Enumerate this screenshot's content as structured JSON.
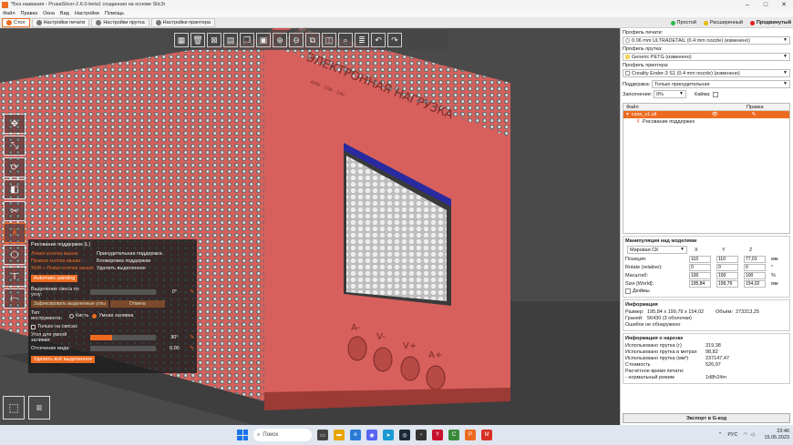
{
  "window": {
    "title": "*Без названия - PrusaSlicer-2.6.0-beta1 созданная на основе Slic3r"
  },
  "menu": [
    "Файл",
    "Правка",
    "Окна",
    "Вид",
    "Настройки",
    "Помощь"
  ],
  "tabs": [
    {
      "label": "Стол"
    },
    {
      "label": "Настройки печати"
    },
    {
      "label": "Настройки прутка"
    },
    {
      "label": "Настройки принтера"
    }
  ],
  "modes": [
    {
      "label": "Простой",
      "color": "#2db84a"
    },
    {
      "label": "Расширенный",
      "color": "#e8b800"
    },
    {
      "label": "Продвинутый",
      "color": "#e02020"
    }
  ],
  "model_text": {
    "embossed": "ЭЛЕКТРОННАЯ НАГРУЗКА",
    "small": "40W · 10A · 24V",
    "buttons": [
      "A-",
      "V-",
      "V+",
      "A+"
    ]
  },
  "top_toolbar_icons": [
    "add-icon",
    "delete-icon",
    "delete-all-icon",
    "arrange-icon",
    "copy-icon",
    "paste-icon",
    "add-instance-icon",
    "remove-instance-icon",
    "split-objects-icon",
    "split-parts-icon",
    "search-icon",
    "layers-icon",
    "undo-icon",
    "redo-icon"
  ],
  "left_toolbar_icons": [
    "move-icon",
    "scale-icon",
    "rotate-icon",
    "place-on-face-icon",
    "cut-icon",
    "supports-paint-icon",
    "seam-paint-icon",
    "emboss-icon",
    "measure-icon"
  ],
  "gizmo": {
    "title": "Рисование поддержек (L)",
    "hints": [
      {
        "key": "Левая кнопка мыши:",
        "action": "Принудительная поддержка"
      },
      {
        "key": "Правая кнопка мыши:",
        "action": "Блокировка поддержки"
      },
      {
        "key": "Shift + Левая кнопка мыши:",
        "action": "Удалить выделенное"
      }
    ],
    "auto_button": "Automatic painting",
    "overhang_label": "Выделение свеса по углу:",
    "overhang_value": "0°",
    "overhang_fraction": 0.0,
    "enforce_button": "Зафиксировать выделенные углы",
    "clear_button": "Отмена",
    "tool_type_label": "Тип инструмента:",
    "tool_brush": "Кисть",
    "tool_smart": "Умная заливка",
    "only_overhangs": "Только на свесах",
    "smart_angle_label": "Угол для умной заливки:",
    "smart_angle_value": "30°",
    "smart_angle_fraction": 0.33,
    "clip_label": "Отсечение вида:",
    "clip_value": "0.00",
    "clip_fraction": 0.0,
    "remove_all_button": "Удалить всё выделенное"
  },
  "right": {
    "print_profile_label": "Профиль печати:",
    "print_profile": "0.06 mm ULTRADETAIL (0.4 mm nozzle) (изменено)",
    "filament_label": "Профиль прутка:",
    "filament": "Generic PETG (изменено)",
    "filament_color": "#f4d35e",
    "printer_label": "Профиль принтера:",
    "printer": "Creality Ender-3 S1 (0.4 mm nozzle) (изменено)",
    "supports_label": "Поддержка:",
    "supports_value": "Только принудительная",
    "infill_label": "Заполнение:",
    "infill_value": "0%",
    "brim_label": "Кайма:",
    "list_head_file": "Файл",
    "list_head_edit": "Правка",
    "object_name": "case_v1.stl",
    "object_child": "Рисование поддержек",
    "manip_title": "Манипуляция над моделями",
    "coord_system": "Мировая СК",
    "axes": [
      "X",
      "Y",
      "Z"
    ],
    "position_label": "Позиция:",
    "position": [
      "110",
      "110",
      "77,01"
    ],
    "position_unit": "мм",
    "rotate_label": "Rotate (relative):",
    "rotate": [
      "0",
      "0",
      "0"
    ],
    "rotate_unit": "°",
    "scale_label": "Масштаб:",
    "scale": [
      "100",
      "100",
      "100"
    ],
    "scale_unit": "%",
    "size_label": "Size [World]:",
    "size": [
      "195,84",
      "199,79",
      "154,02"
    ],
    "size_unit": "мм",
    "inches_label": "Дюймы",
    "info_title": "Информация",
    "info_size_label": "Размер:",
    "info_size": "195,84 x 199,79 x 154,02",
    "info_volume_label": "Объём:",
    "info_volume": "273313,25",
    "info_facets_label": "Граней:",
    "info_facets": "56430 (3 оболочки)",
    "info_errors": "Ошибок не обнаружено",
    "slice_title": "Информация о нарезке",
    "slice_rows": [
      {
        "k": "Использовано прутка (г)",
        "v": "319,38"
      },
      {
        "k": "Использовано прутка в метрах",
        "v": "98,82"
      },
      {
        "k": "Использовано прутка (мм³)",
        "v": "237147,47"
      },
      {
        "k": "Стоимость",
        "v": "526,97"
      },
      {
        "k": "Расчётное время печати:",
        "v": ""
      },
      {
        "k": "- нормальный режим",
        "v": "1d8h24m"
      }
    ],
    "export_button": "Экспорт в G-код"
  },
  "taskbar": {
    "search": "Поиск",
    "lang": "РУС",
    "time": "23:46",
    "date": "15.05.2023"
  }
}
